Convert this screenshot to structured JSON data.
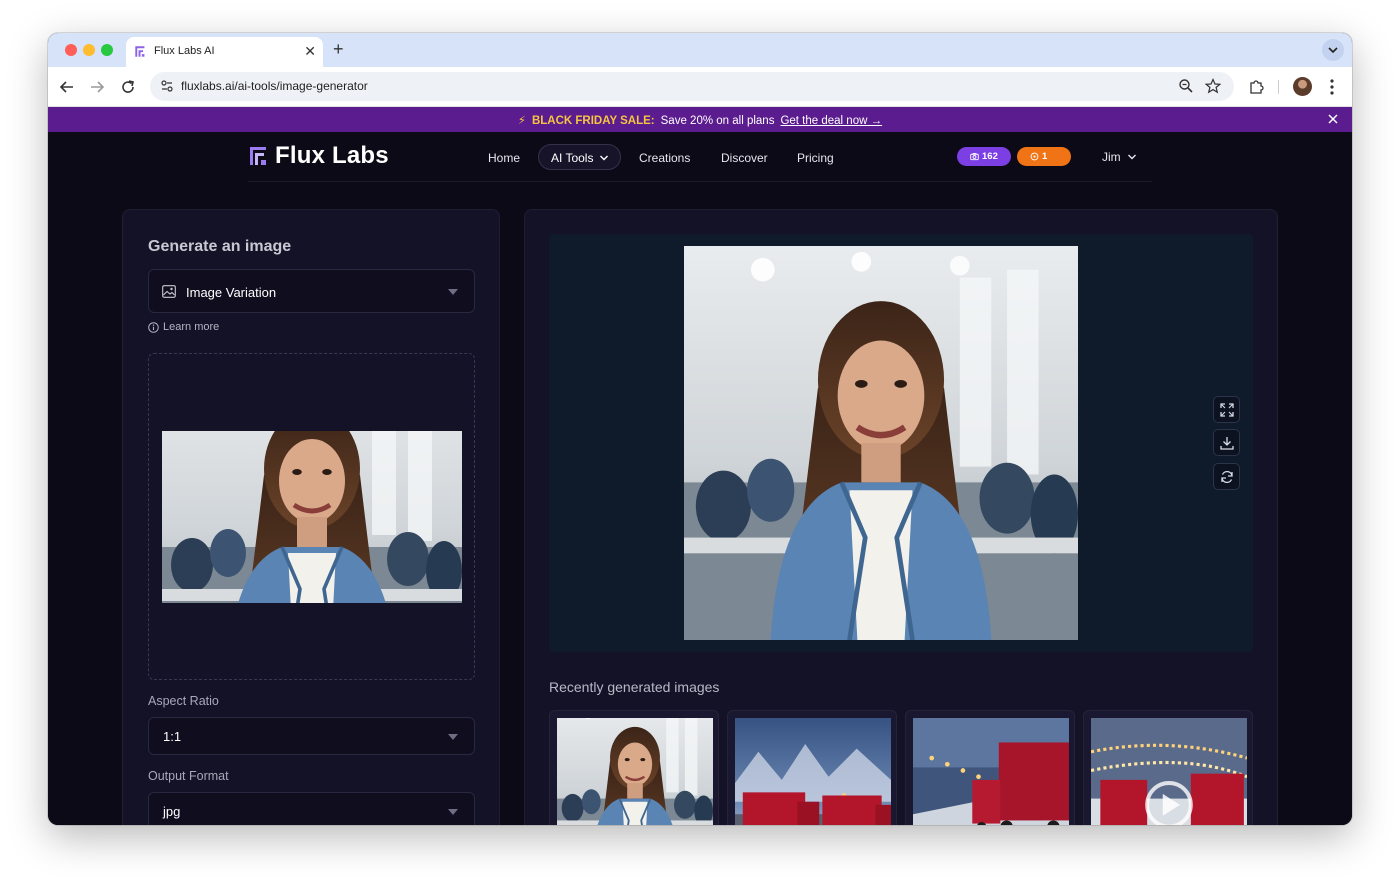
{
  "browser": {
    "tab_title": "Flux Labs AI",
    "new_tab_symbol": "+",
    "close_symbol": "✕",
    "url": "fluxlabs.ai/ai-tools/image-generator"
  },
  "promo": {
    "bolt": "⚡",
    "sale_label": "BLACK FRIDAY SALE:",
    "message": "Save 20% on all plans",
    "link_label": "Get the deal now →"
  },
  "header": {
    "logo_text": "Flux Labs",
    "nav": {
      "home": "Home",
      "ai_tools": "AI Tools",
      "creations": "Creations",
      "discover": "Discover",
      "pricing": "Pricing"
    },
    "credits": {
      "images": "162",
      "videos": "1"
    },
    "user_name": "Jim"
  },
  "generator": {
    "title": "Generate an image",
    "mode_selected": "Image Variation",
    "learn_more": "Learn more",
    "aspect_ratio_label": "Aspect Ratio",
    "aspect_ratio_value": "1:1",
    "output_format_label": "Output Format",
    "output_format_value": "jpg"
  },
  "preview": {
    "recent_title": "Recently generated images"
  },
  "colors": {
    "page_bg": "#0c0a17",
    "panel_bg": "#141226",
    "promo_bg": "#5b1c8f",
    "promo_accent": "#f5c542",
    "badge_purple": "#7b3fe4",
    "badge_orange": "#f07415"
  }
}
